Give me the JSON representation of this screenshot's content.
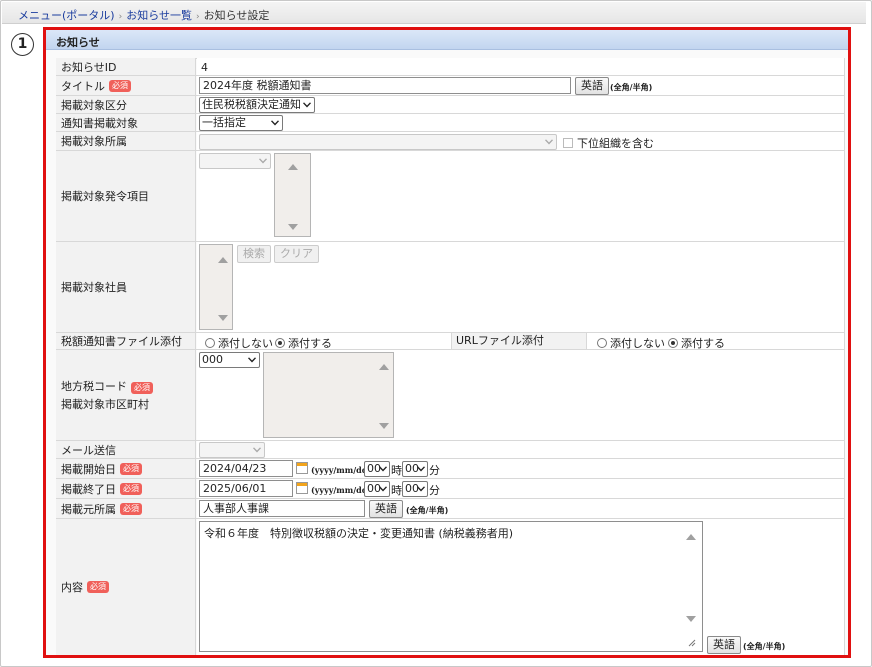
{
  "breadcrumb": {
    "item1": "メニュー(ポータル)",
    "item2": "お知らせ一覧",
    "current": "お知らせ設定",
    "separator": "›"
  },
  "step_number": "①",
  "section_title": "お知らせ",
  "required_label": "必須",
  "hint_fullhalf": "(全角/半角)",
  "date_format_hint": "(yyyy/mm/dd)",
  "english_button": "英語",
  "fields": {
    "notice_id": {
      "label": "お知らせID",
      "value": "4"
    },
    "title": {
      "label": "タイトル",
      "value": "2024年度  税額通知書"
    },
    "target_category": {
      "label": "掲載対象区分",
      "value": "住民税税額決定通知"
    },
    "notice_target": {
      "label": "通知書掲載対象",
      "value": "一括指定"
    },
    "target_dept": {
      "label": "掲載対象所属",
      "value": "",
      "sub_checkbox": "下位組織を含む"
    },
    "target_order_items": {
      "label": "掲載対象発令項目"
    },
    "target_employees": {
      "label": "掲載対象社員",
      "search_btn": "検索",
      "clear_btn": "クリア"
    },
    "tax_file_attach": {
      "label": "税額通知書ファイル添付",
      "opt_no": "添付しない",
      "opt_yes": "添付する",
      "selected": "添付する"
    },
    "url_file_attach": {
      "label": "URLファイル添付",
      "opt_no": "添付しない",
      "opt_yes": "添付する",
      "selected": "添付する"
    },
    "local_tax_code": {
      "label1": "地方税コード",
      "label2": "掲載対象市区町村",
      "value": "000"
    },
    "mail_send": {
      "label": "メール送信",
      "value": ""
    },
    "start_date": {
      "label": "掲載開始日",
      "date": "2024/04/23",
      "hour": "00",
      "minute": "00",
      "hour_unit": "時",
      "minute_unit": "分"
    },
    "end_date": {
      "label": "掲載終了日",
      "date": "2025/06/01",
      "hour": "00",
      "minute": "00",
      "hour_unit": "時",
      "minute_unit": "分"
    },
    "source_dept": {
      "label": "掲載元所属",
      "value": "人事部人事課"
    },
    "content": {
      "label": "内容",
      "value": "令和６年度　特別徴収税額の決定・変更通知書 (納税義務者用)"
    }
  }
}
